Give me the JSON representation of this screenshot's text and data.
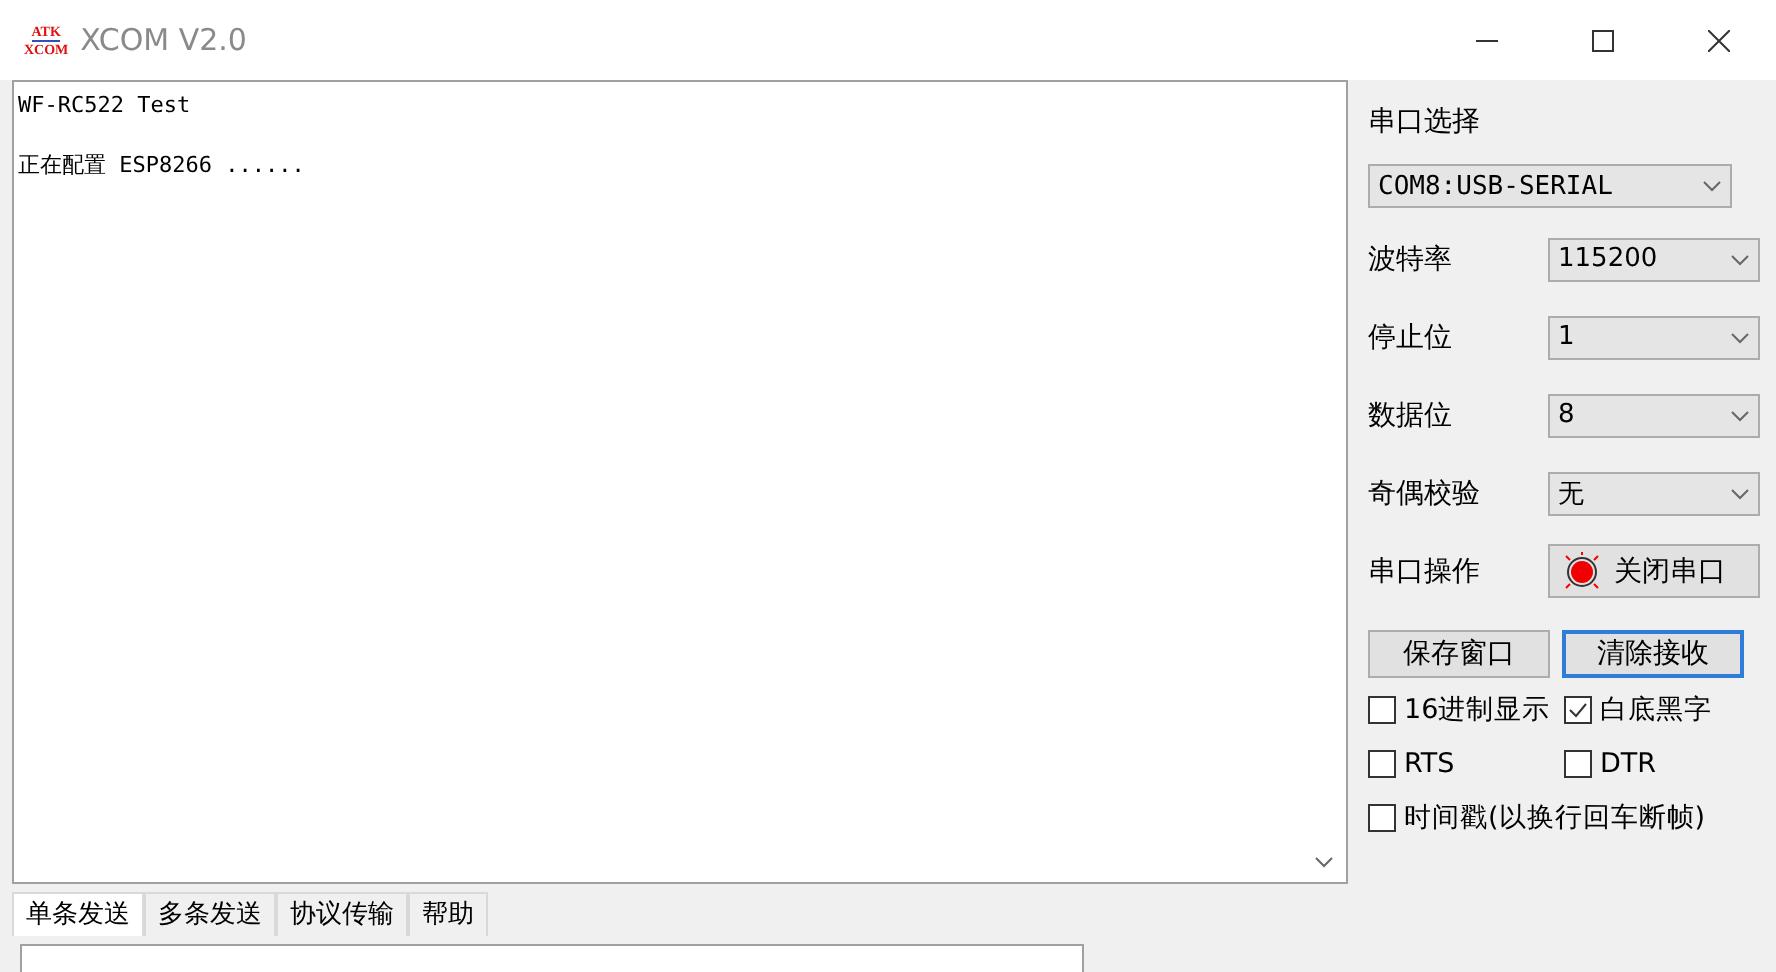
{
  "window": {
    "logo_top": "ATK",
    "logo_bottom": "XCOM",
    "title": "XCOM V2.0"
  },
  "receive": {
    "lines": [
      "WF-RC522 Test",
      "正在配置 ESP8266 ......"
    ]
  },
  "port_select": {
    "label": "串口选择",
    "value": "COM8:USB-SERIAL"
  },
  "settings": [
    {
      "label": "波特率",
      "value": "115200"
    },
    {
      "label": "停止位",
      "value": "1"
    },
    {
      "label": "数据位",
      "value": "8"
    },
    {
      "label": "奇偶校验",
      "value": "无"
    }
  ],
  "port_operation": {
    "label": "串口操作",
    "button": "关闭串口",
    "open": true
  },
  "buttons": [
    {
      "label": "保存窗口",
      "focused": false
    },
    {
      "label": "清除接收",
      "focused": true
    }
  ],
  "options": [
    [
      {
        "label": "16进制显示",
        "checked": false
      },
      {
        "label": "白底黑字",
        "checked": true
      }
    ],
    [
      {
        "label": "RTS",
        "checked": false
      },
      {
        "label": "DTR",
        "checked": false
      }
    ],
    [
      {
        "label": "时间戳(以换行回车断帧)",
        "checked": false
      }
    ]
  ],
  "tabs": [
    {
      "label": "单条发送",
      "selected": true
    },
    {
      "label": "多条发送",
      "selected": false
    },
    {
      "label": "协议传输",
      "selected": false
    },
    {
      "label": "帮助",
      "selected": false
    }
  ]
}
